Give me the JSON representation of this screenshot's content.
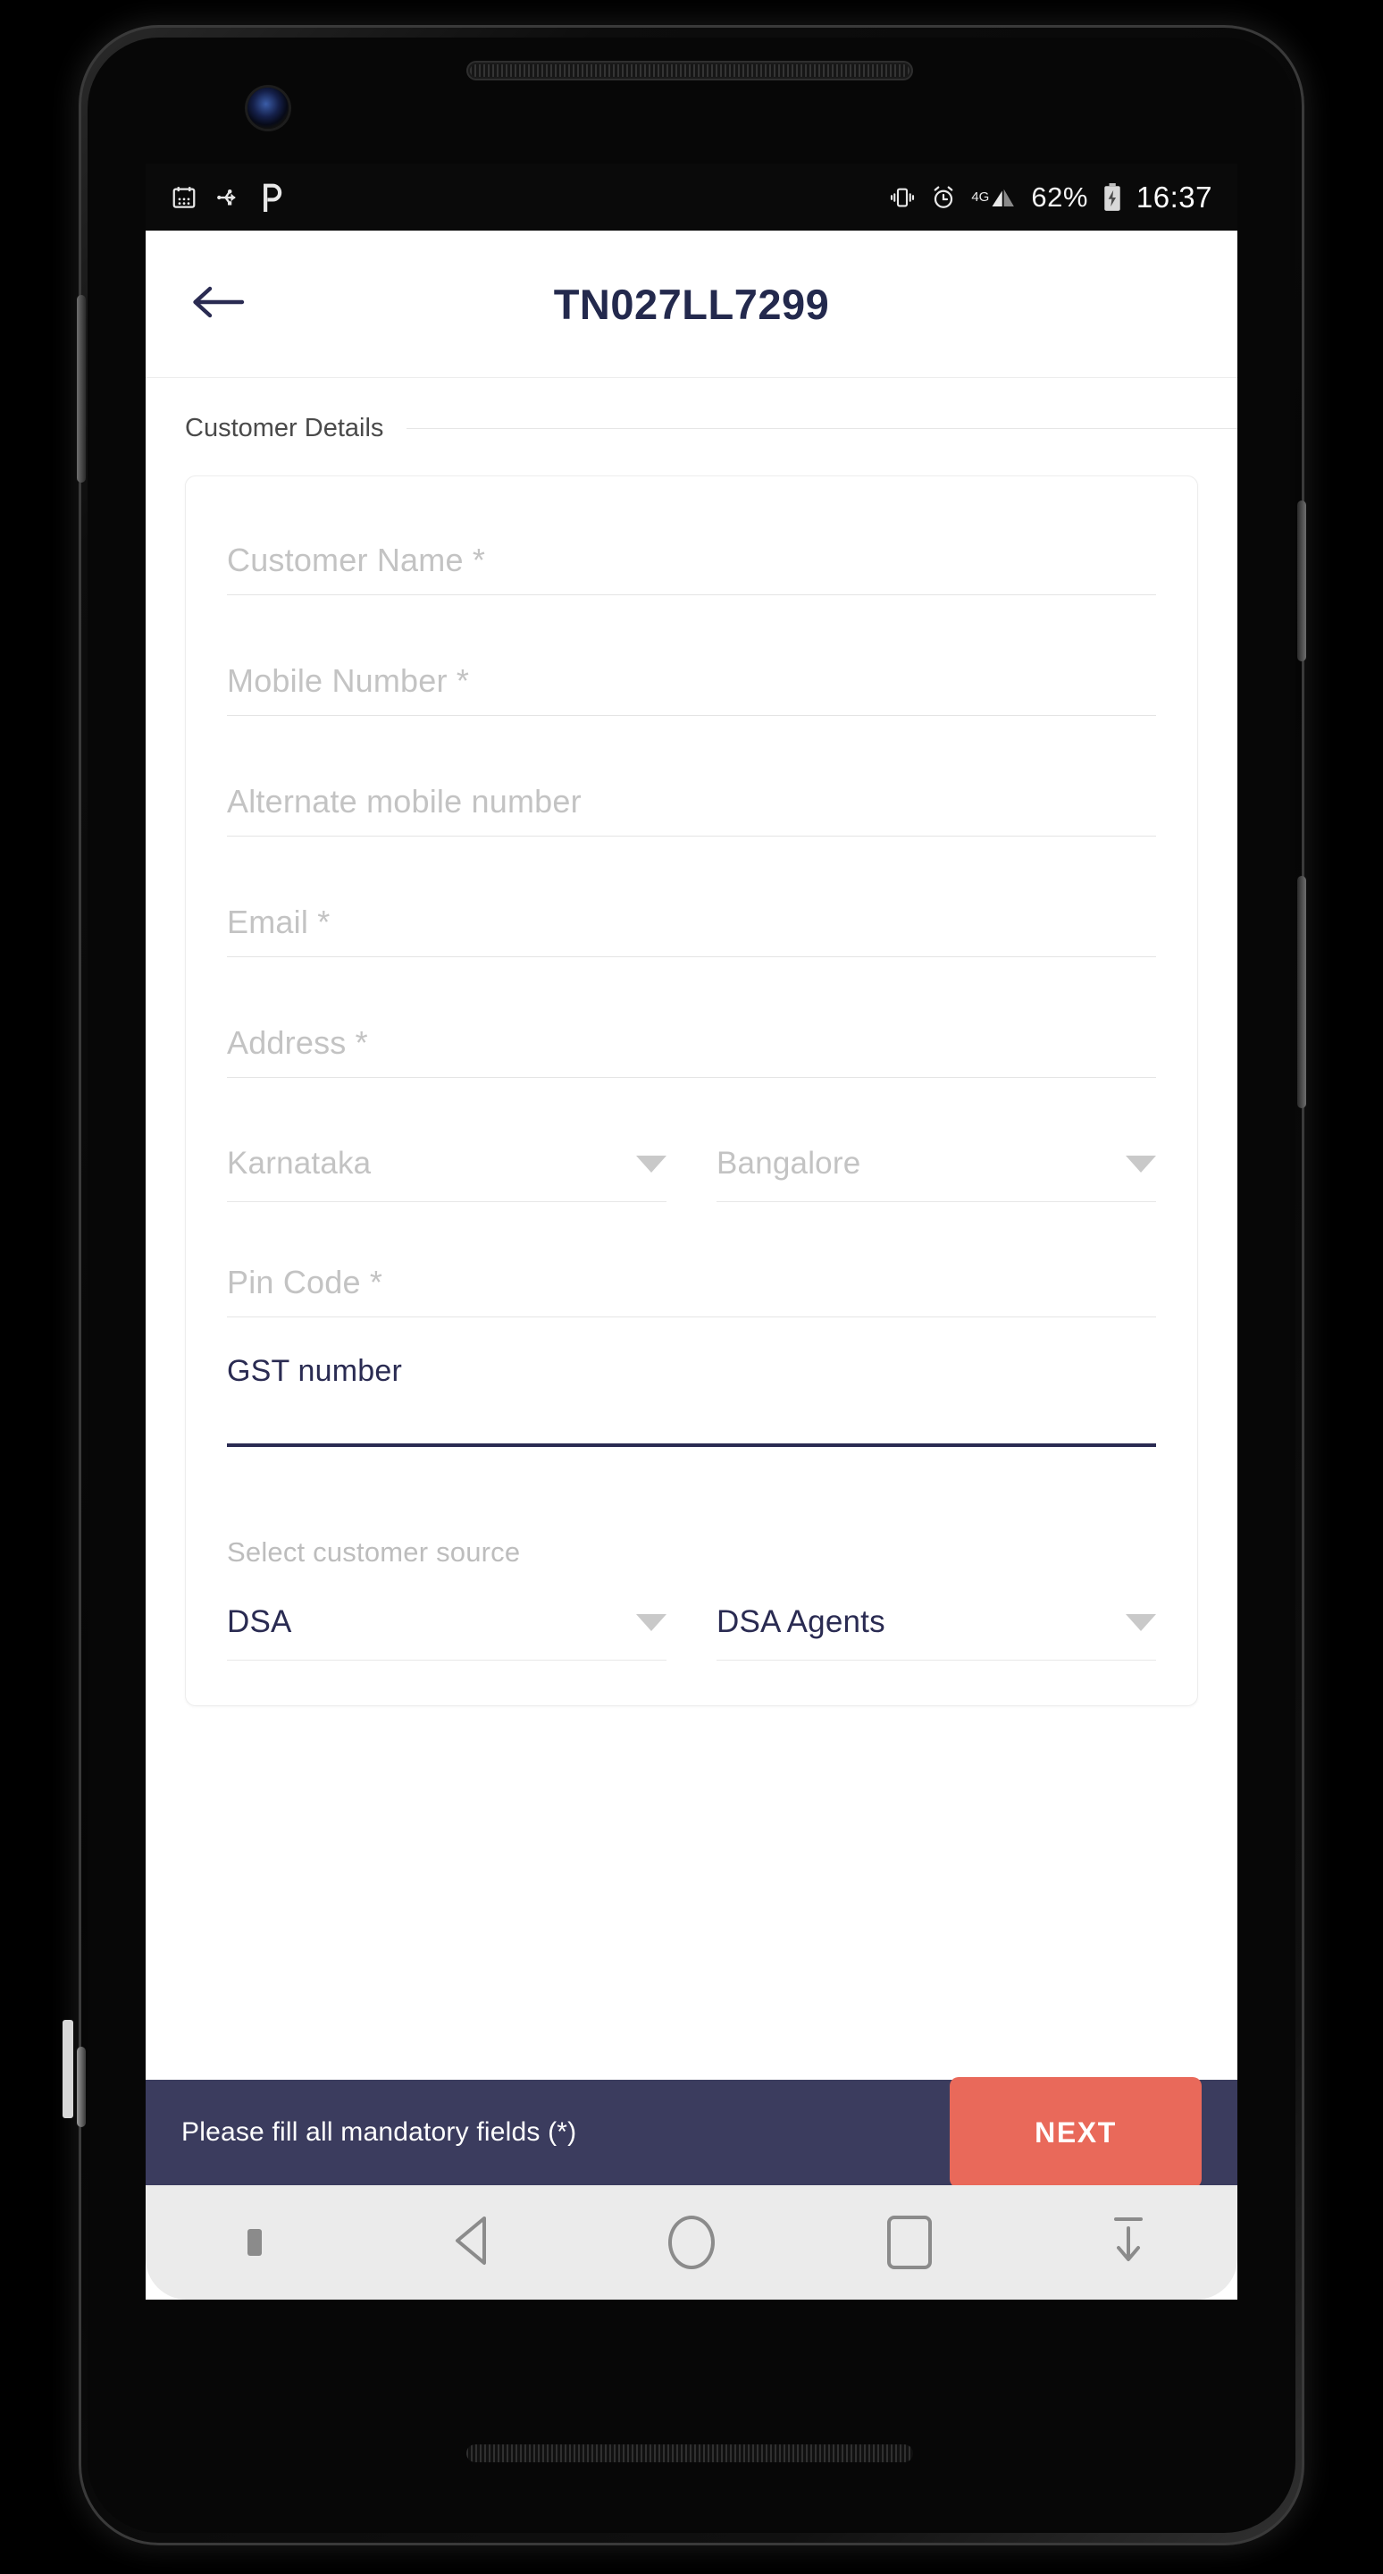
{
  "status_bar": {
    "left_icons": [
      "calendar-icon",
      "usb-icon",
      "paytm-icon"
    ],
    "right_icons": [
      "vibrate-icon",
      "alarm-icon",
      "signal-icon",
      "battery-charging-icon"
    ],
    "network": "4G",
    "battery_percent": "62%",
    "time": "16:37"
  },
  "app_bar": {
    "back_icon": "arrow-left-icon",
    "title": "TN027LL7299"
  },
  "section": {
    "title": "Customer Details"
  },
  "form": {
    "customer_name": {
      "placeholder": "Customer Name *",
      "value": ""
    },
    "mobile_number": {
      "placeholder": "Mobile Number *",
      "value": ""
    },
    "alternate_mobile": {
      "placeholder": "Alternate mobile number",
      "value": ""
    },
    "email": {
      "placeholder": "Email *",
      "value": ""
    },
    "address": {
      "placeholder": "Address *",
      "value": ""
    },
    "state": {
      "placeholder": "Karnataka",
      "value": "",
      "caret": "chevron-down-icon"
    },
    "city": {
      "placeholder": "Bangalore",
      "value": "",
      "caret": "chevron-down-icon"
    },
    "pin_code": {
      "placeholder": "Pin Code *",
      "value": ""
    },
    "gst_number": {
      "label": "GST number",
      "value": "",
      "focused": true
    },
    "customer_source_label": "Select customer source",
    "source_type": {
      "value": "DSA",
      "caret": "chevron-down-icon"
    },
    "source_agent": {
      "value": "DSA Agents",
      "caret": "chevron-down-icon"
    }
  },
  "action_bar": {
    "message": "Please fill all mandatory fields (*)",
    "next_label": "NEXT"
  },
  "nav_bar": {
    "items": [
      "dot-indicator",
      "back-triangle-icon",
      "home-circle-icon",
      "recents-square-icon",
      "hide-keyboard-icon"
    ]
  },
  "colors": {
    "brand_navy": "#2a2b52",
    "action_bar_bg": "#3b3c5e",
    "next_button": "#e9695a",
    "placeholder_grey": "#c3c3c3"
  }
}
